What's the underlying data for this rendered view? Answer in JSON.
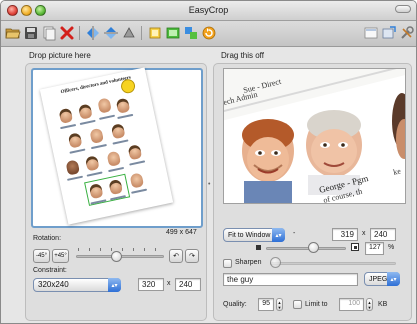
{
  "window": {
    "title": "EasyCrop"
  },
  "toolbar": {
    "icons": [
      "open-folder-icon",
      "save-icon",
      "copy-icon",
      "delete-icon",
      "flip-horizontal-icon",
      "flip-vertical-icon",
      "rotate-icon",
      "crop-icon",
      "fit-icon",
      "sync-icon",
      "undo-icon",
      "screenshot-icon",
      "share-icon",
      "tools-icon"
    ]
  },
  "left_panel": {
    "label": "Drop picture here",
    "image_size": "499 x 647",
    "sheet_title": "Officers, directors and volunteers",
    "rotation_label": "Rotation:",
    "rotate_ccw45_label": "-45°",
    "rotate_cw45_label": "+45°",
    "constraint_label": "Constraint:",
    "constraint_value": "320x240",
    "width_value": "320",
    "x_label": "x",
    "height_value": "240"
  },
  "right_panel": {
    "label": "Drag this off",
    "preview_texts": [
      "Sue - Direct",
      "ech Admin",
      "George - Pgm",
      "of course, th",
      "ke"
    ],
    "fit_value": "Fit to Window",
    "fit_minus": "-",
    "width_value": "319",
    "x_label": "x",
    "height_value": "240",
    "zoom_value": "127",
    "zoom_unit": "%",
    "sharpen_label": "Sharpen",
    "filename_value": "the guy",
    "format_value": "JPEG",
    "quality_label": "Quality:",
    "quality_value": "95",
    "limit_label": "Limit to",
    "limit_value": "100",
    "limit_unit": "KB"
  }
}
